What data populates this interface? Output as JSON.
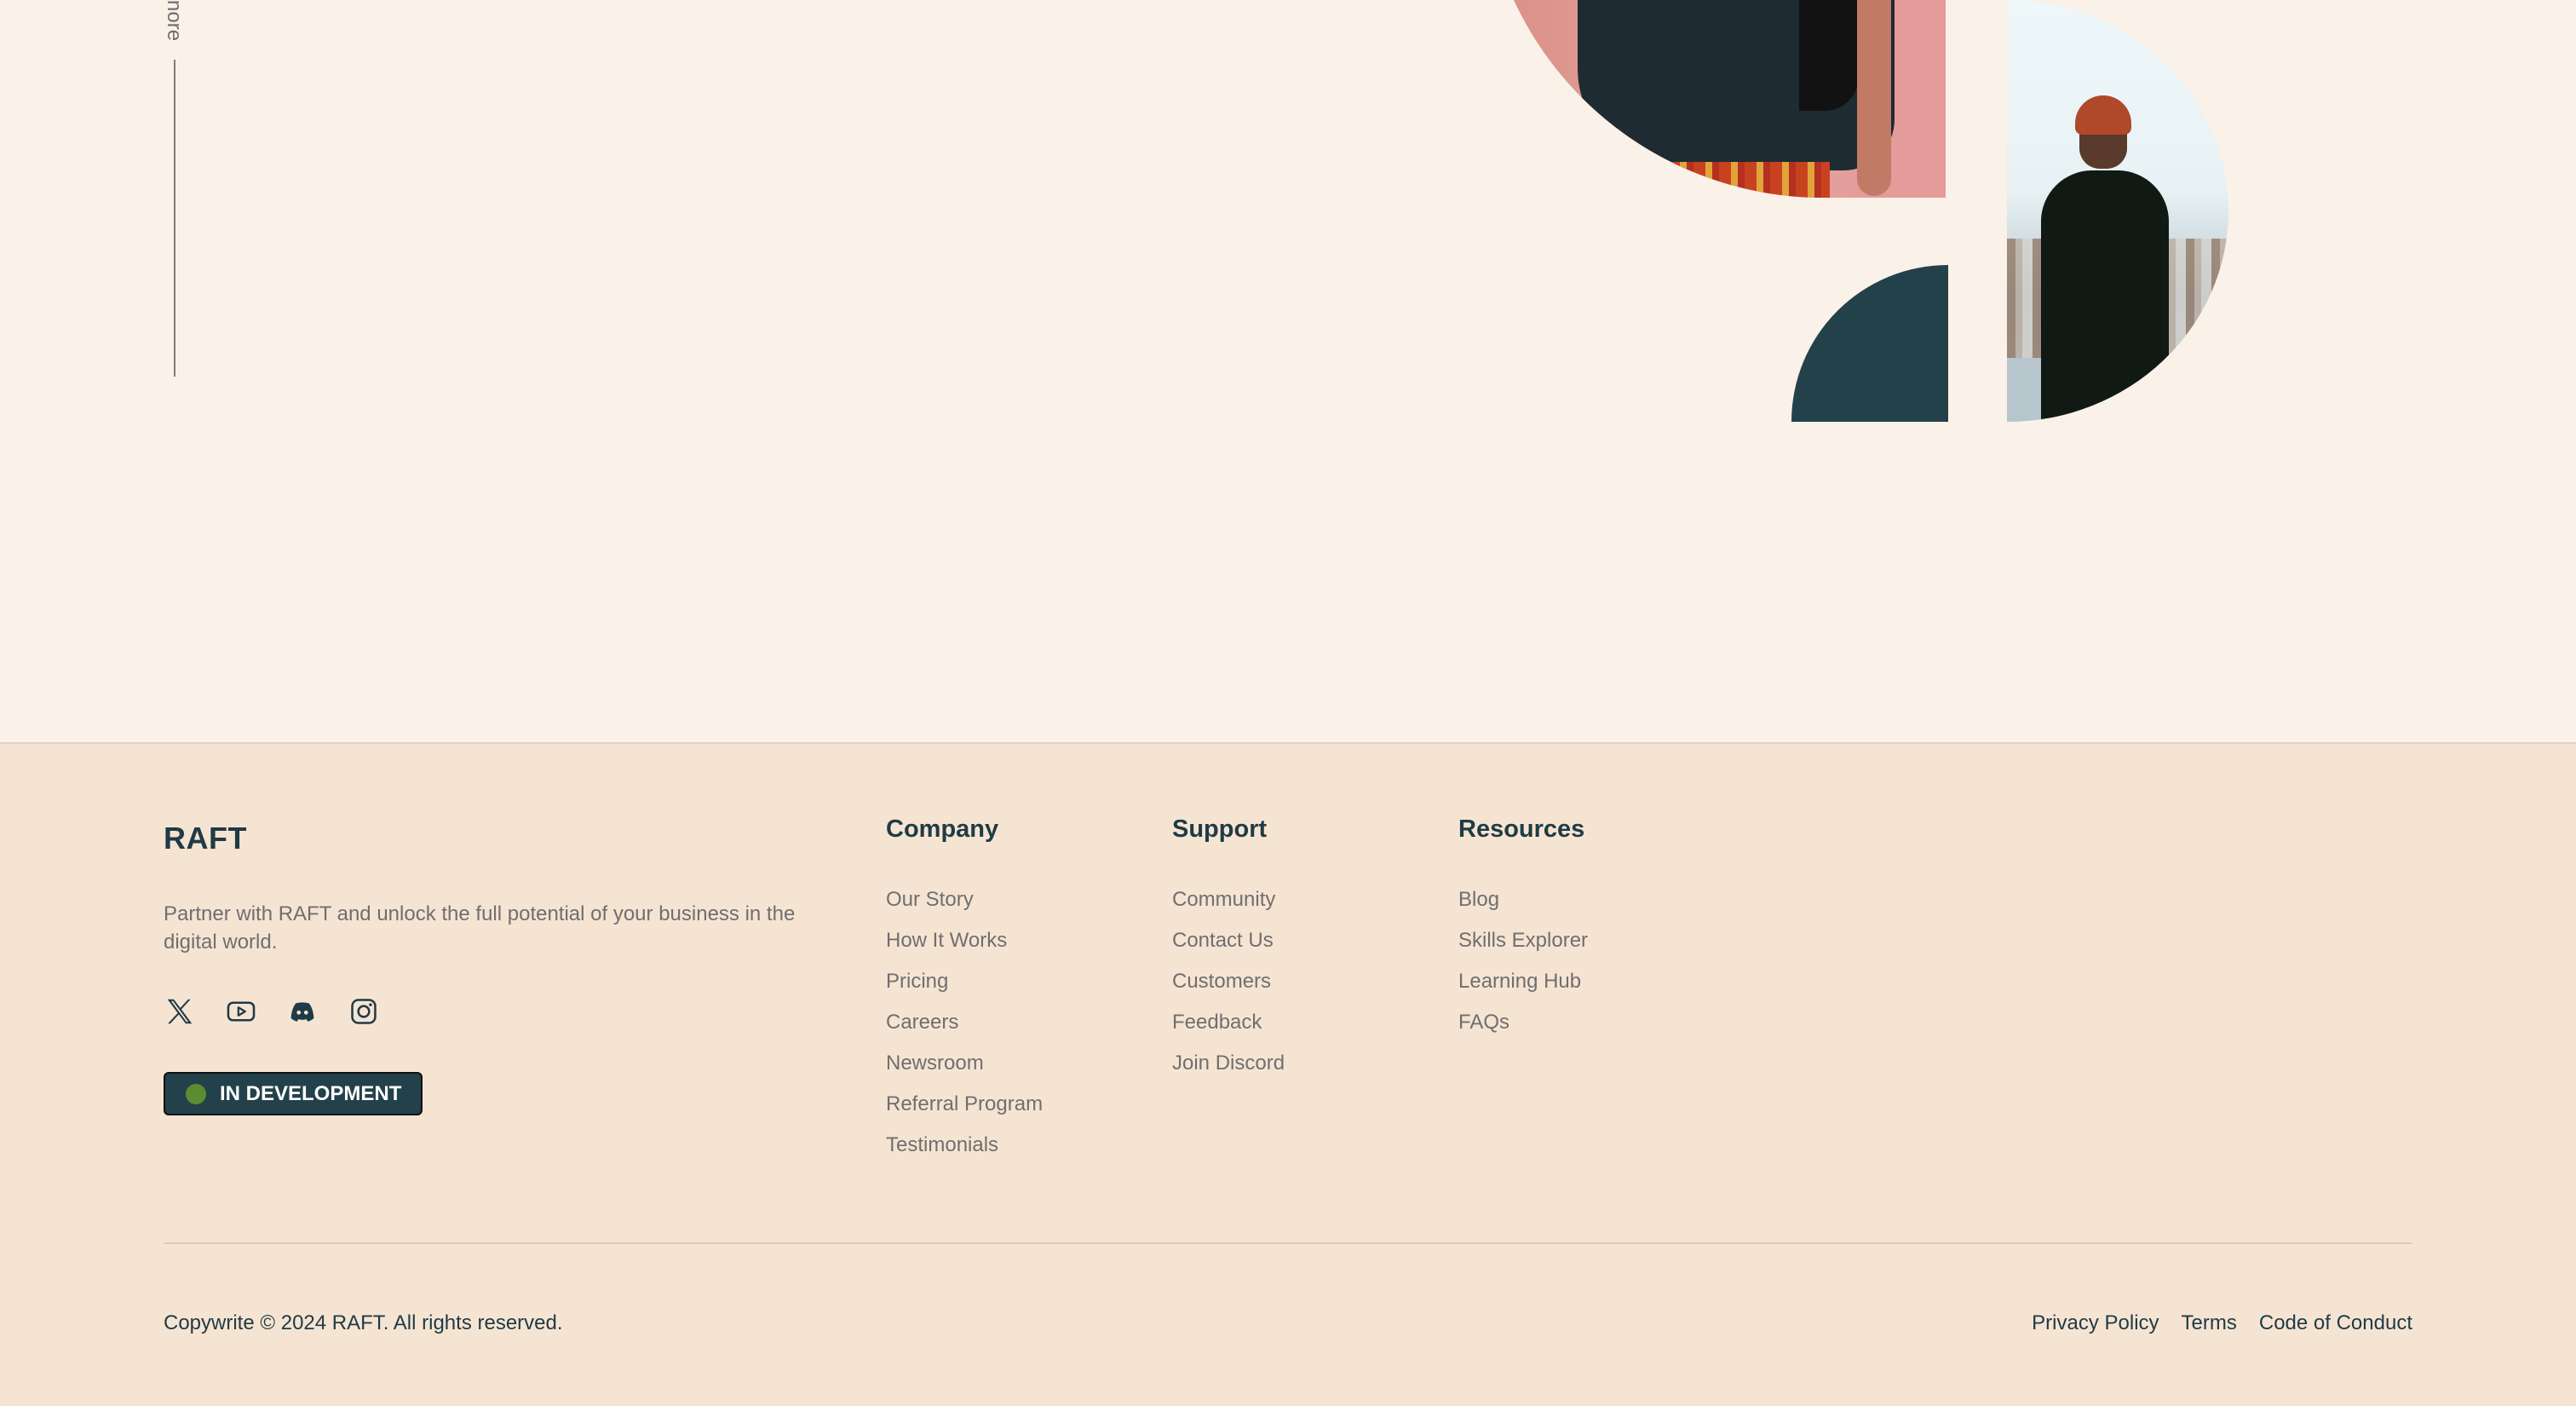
{
  "hero": {
    "scroll_hint": "nore"
  },
  "footer": {
    "brand": "RAFT",
    "tagline": "Partner with RAFT and unlock the full potential of your business in the digital world.",
    "socials": [
      "x-icon",
      "youtube-icon",
      "discord-icon",
      "instagram-icon"
    ],
    "status": {
      "label": "IN DEVELOPMENT",
      "dot_color": "#5C8C32"
    },
    "columns": [
      {
        "title": "Company",
        "links": [
          "Our Story",
          "How It Works",
          "Pricing",
          "Careers",
          "Newsroom",
          "Referral Program",
          "Testimonials"
        ]
      },
      {
        "title": "Support",
        "links": [
          "Community",
          "Contact Us",
          "Customers",
          "Feedback",
          "Join Discord"
        ]
      },
      {
        "title": "Resources",
        "links": [
          "Blog",
          "Skills Explorer",
          "Learning Hub",
          "FAQs"
        ]
      }
    ],
    "copyright": "Copywrite © 2024 RAFT. All rights reserved.",
    "legal": [
      "Privacy Policy",
      "Terms",
      "Code of Conduct"
    ]
  },
  "colors": {
    "background": "#FAF1E8",
    "footer_background": "#F6E4D3",
    "brand_dark": "#1F3B45",
    "accent_pink": "#E2A39C"
  }
}
